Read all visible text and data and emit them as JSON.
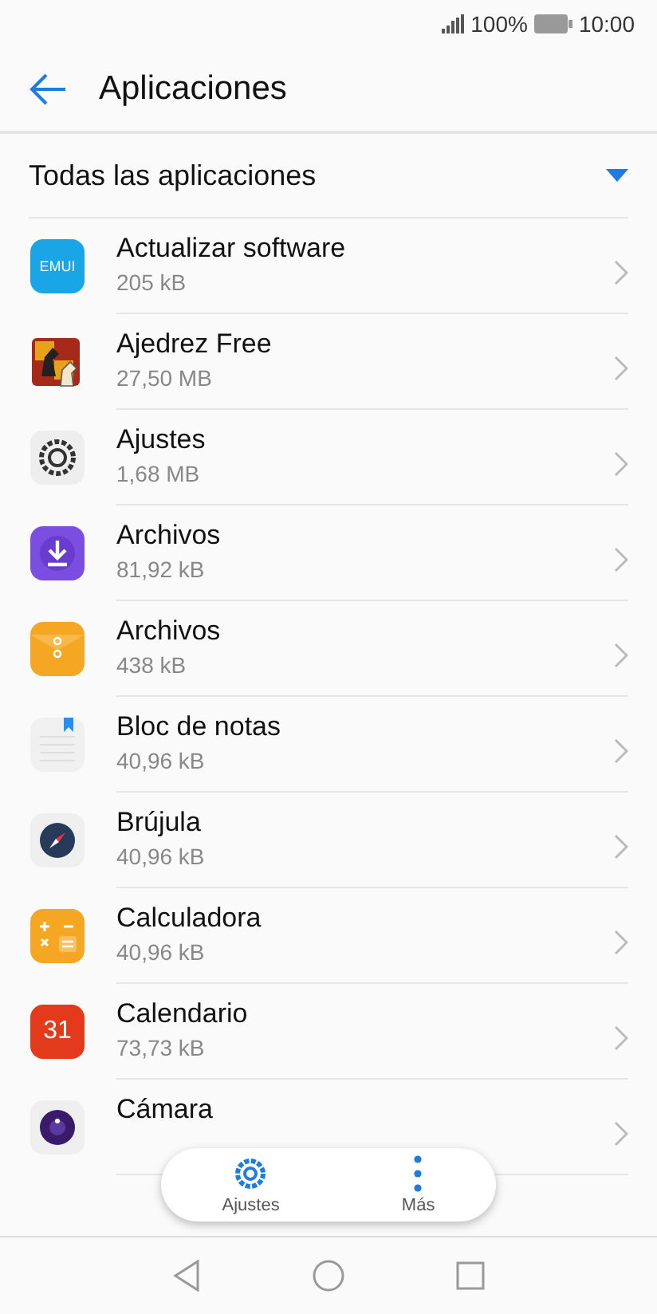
{
  "status_bar": {
    "battery": "100%",
    "time": "10:00"
  },
  "app_bar": {
    "title": "Aplicaciones"
  },
  "filter": {
    "label": "Todas las aplicaciones"
  },
  "apps": [
    {
      "name": "Actualizar software",
      "size": "205 kB",
      "kind": "emui",
      "icon_text": "EMUI"
    },
    {
      "name": "Ajedrez Free",
      "size": "27,50 MB",
      "kind": "chess"
    },
    {
      "name": "Ajustes",
      "size": "1,68 MB",
      "kind": "settings"
    },
    {
      "name": "Archivos",
      "size": "81,92 kB",
      "kind": "download"
    },
    {
      "name": "Archivos",
      "size": "438 kB",
      "kind": "envelope"
    },
    {
      "name": "Bloc de notas",
      "size": "40,96 kB",
      "kind": "notes"
    },
    {
      "name": "Brújula",
      "size": "40,96 kB",
      "kind": "compass"
    },
    {
      "name": "Calculadora",
      "size": "40,96 kB",
      "kind": "calculator"
    },
    {
      "name": "Calendario",
      "size": "73,73 kB",
      "kind": "calendar",
      "icon_text": "31"
    },
    {
      "name": "Cámara",
      "kind": "camera"
    }
  ],
  "floating_bar": [
    {
      "label": "Ajustes",
      "kind": "settings"
    },
    {
      "label": "Más",
      "kind": "more"
    }
  ]
}
